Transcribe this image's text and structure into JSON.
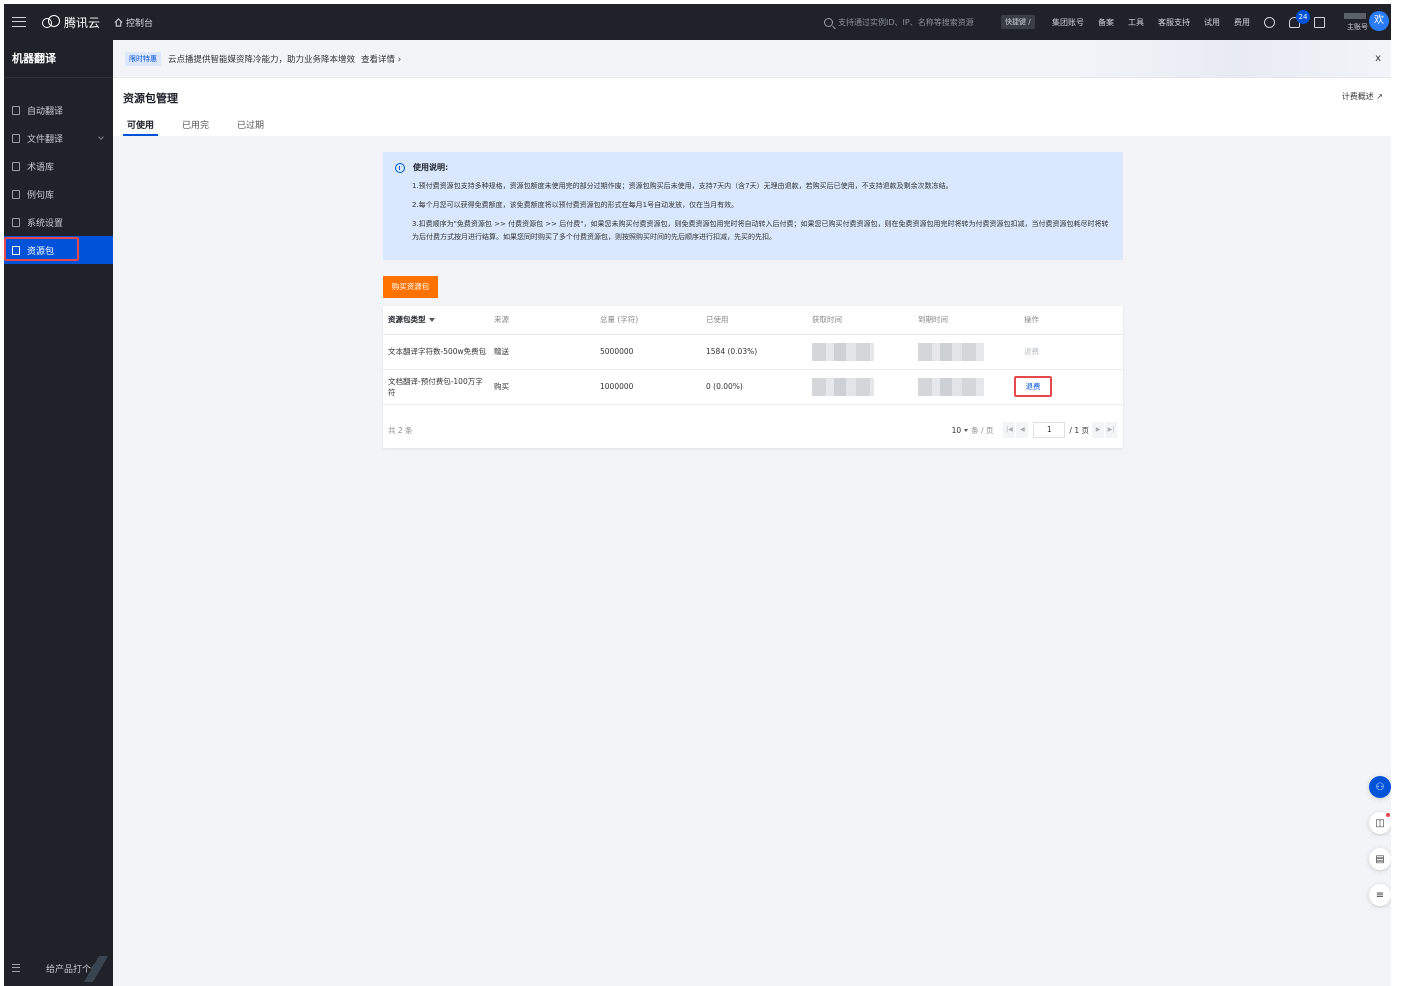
{
  "topbar": {
    "brand": "腾讯云",
    "console": "控制台",
    "search_placeholder": "支持通过实例ID、IP、名称等搜索资源",
    "shortcut": "快捷键 /",
    "items": [
      "集团账号",
      "备案",
      "工具",
      "客服支持",
      "试用",
      "费用"
    ],
    "notification_count": "24",
    "account_label": "主账号",
    "avatar_char": "欢"
  },
  "sidebar": {
    "title": "机器翻译",
    "items": [
      {
        "label": "自动翻译",
        "icon": "translate-icon"
      },
      {
        "label": "文件翻译",
        "icon": "file-icon"
      },
      {
        "label": "术语库",
        "icon": "glossary-icon"
      },
      {
        "label": "例句库",
        "icon": "example-icon"
      },
      {
        "label": "系统设置",
        "icon": "settings-icon"
      },
      {
        "label": "资源包",
        "icon": "package-icon"
      }
    ],
    "footer": "给产品打个分"
  },
  "notice": {
    "tag": "限时特惠",
    "text": "云点播提供智能媒资降冷能力，助力业务降本增效",
    "link": "查看详情 ›",
    "close": "x"
  },
  "page": {
    "title": "资源包管理",
    "billing_link": "计费概述",
    "tabs": [
      "可使用",
      "已用完",
      "已过期"
    ]
  },
  "info": {
    "heading": "使用说明:",
    "lines": [
      "1.预付费资源包支持多种规格，资源包额度未使用完的部分过期作废；资源包购买后未使用，支持7天内（含7天）无理由退款，若购买后已使用，不支持退款及剩余次数冻结。",
      "2.每个月您可以获得免费额度，该免费额度将以预付费资源包的形式在每月1号自动发放，仅在当月有效。",
      "3.扣费顺序为\"免费资源包 >> 付费资源包 >> 后付费\"，如果您未购买付费资源包，则免费资源包用完时将自动转入后付费；如果您已购买付费资源包，则在免费资源包用完时将转为付费资源包扣减，当付费资源包耗尽时将转为后付费方式按月进行结算。如果您同时购买了多个付费资源包，则按照购买时间的先后顺序进行扣减，先买的先扣。"
    ]
  },
  "buy_button": "购买资源包",
  "table": {
    "headers": [
      "资源包类型",
      "来源",
      "总量 (字符)",
      "已使用",
      "获取时间",
      "到期时间",
      "操作"
    ],
    "rows": [
      {
        "type": "文本翻译字符数-500w免费包",
        "source": "赠送",
        "total": "5000000",
        "used": "1584 (0.03%)",
        "action": "退费",
        "enabled": false
      },
      {
        "type": "文档翻译-预付费包-100万字符",
        "source": "购买",
        "total": "1000000",
        "used": "0 (0.00%)",
        "action": "退费",
        "enabled": true
      }
    ],
    "total_text": "共 2 条",
    "page_size": "10",
    "per_page": "条 / 页",
    "current_page": "1",
    "total_pages": "/ 1 页"
  },
  "colors": {
    "accent": "#0052d9",
    "buy_button": "#ff7200",
    "highlight": "#e5484d",
    "sidebar_bg": "#1f2329"
  }
}
